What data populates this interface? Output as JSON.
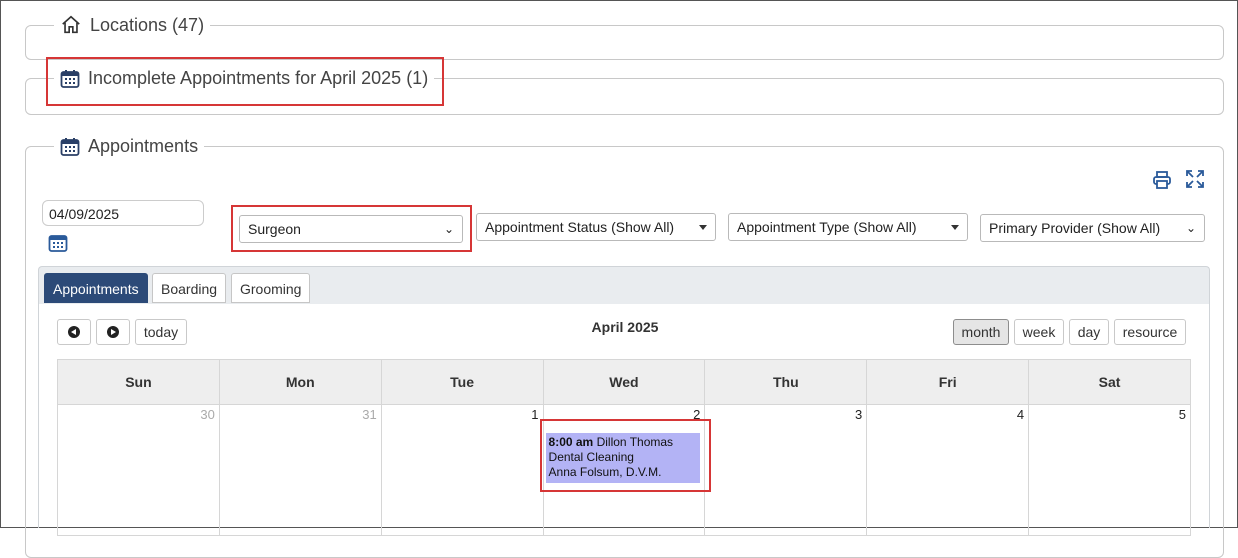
{
  "panels": {
    "locations": {
      "title": "Locations (47)"
    },
    "incomplete": {
      "title": "Incomplete Appointments for April 2025 (1)"
    },
    "appointments": {
      "title": "Appointments"
    }
  },
  "filters": {
    "date_value": "04/09/2025",
    "category_select": "Surgeon",
    "status_select": "Appointment Status (Show All)",
    "type_select": "Appointment Type (Show All)",
    "provider_select": "Primary Provider (Show All)"
  },
  "tabs": [
    {
      "label": "Appointments",
      "active": true
    },
    {
      "label": "Boarding",
      "active": false
    },
    {
      "label": "Grooming",
      "active": false
    }
  ],
  "calendar": {
    "title": "April 2025",
    "today_label": "today",
    "views": [
      "month",
      "week",
      "day",
      "resource"
    ],
    "active_view": "month",
    "weekdays": [
      "Sun",
      "Mon",
      "Tue",
      "Wed",
      "Thu",
      "Fri",
      "Sat"
    ],
    "days": [
      "30",
      "31",
      "1",
      "2",
      "3",
      "4",
      "5"
    ],
    "event": {
      "time": "8:00 am",
      "patient": "Dillon Thomas",
      "service": "Dental Cleaning",
      "provider": "Anna Folsum, D.V.M."
    }
  },
  "colors": {
    "accent": "#2c4a78",
    "highlight_border": "#d63636",
    "event_bg": "#b3b3f5",
    "icon_blue": "#2a5a9a"
  }
}
